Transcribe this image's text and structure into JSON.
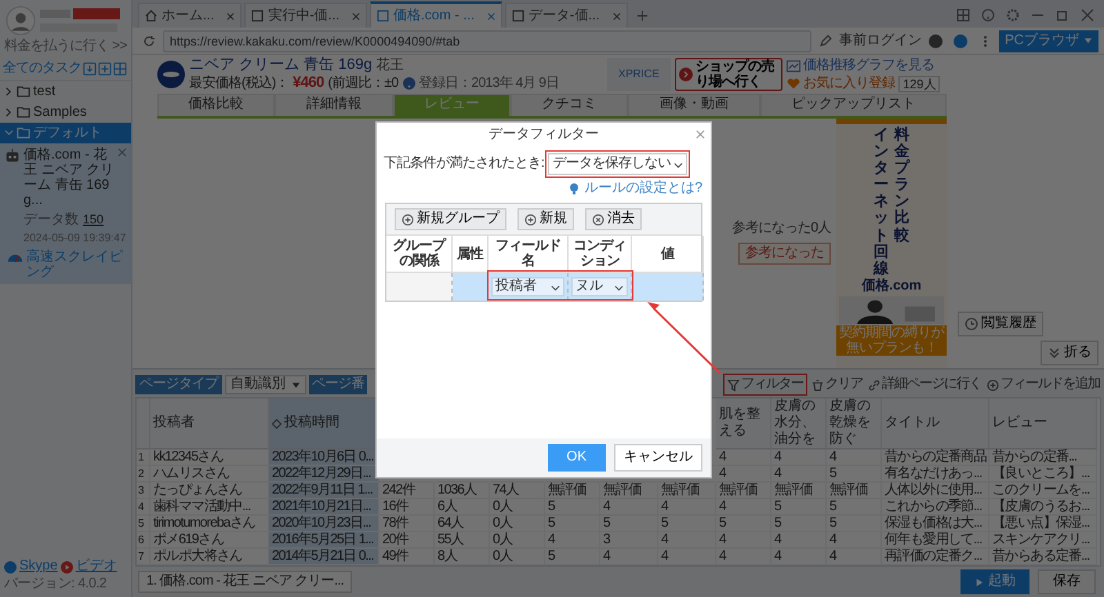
{
  "sidebar": {
    "upgrade_link": "料金を払うに行く >>",
    "tasks_title": "全てのタスク",
    "tree": [
      {
        "label": "test",
        "expanded": false,
        "selected": false
      },
      {
        "label": "Samples",
        "expanded": false,
        "selected": false
      },
      {
        "label": "デフォルト",
        "expanded": true,
        "selected": true,
        "tasks": [
          {
            "title": "価格.com - 花王 ニベア クリーム 青缶 169g...",
            "data_label": "データ数",
            "data_count": "150",
            "timestamp": "2024-05-09 19:39:47",
            "mode": "高速スクレイピング"
          }
        ]
      }
    ],
    "footer_links": [
      "Skype",
      "ビデオ"
    ],
    "version": "バージョン: 4.0.2"
  },
  "browser": {
    "tabs": [
      {
        "kind": "home",
        "label": "ホーム...",
        "selected": false
      },
      {
        "kind": "page",
        "label": "実行中-価...",
        "selected": false
      },
      {
        "kind": "page",
        "label": "価格.com - ...",
        "selected": true
      },
      {
        "kind": "page",
        "label": "データ-価...",
        "selected": false
      }
    ],
    "url": "https://review.kakaku.com/review/K0000494090/#tab",
    "login": "事前ログイン",
    "mode_button": "PCブラウザ"
  },
  "page": {
    "product": "ニベア クリーム 青缶 169g",
    "maker": "花王",
    "price_label": "最安価格(税込)：",
    "price": "¥460",
    "change": "(前週比：±0",
    "registered": "登録日：2013年 4月 9日",
    "shop_name": "XPRICE",
    "shop_button": "ショップの売り場へ行く",
    "chart_link": "価格推移グラフを見る",
    "favorite_link": "お気に入り登録",
    "favorite_count": "129人",
    "tabs": [
      {
        "label": "価格比較",
        "selected": false
      },
      {
        "label": "詳細情報",
        "selected": false
      },
      {
        "label": "レビュー",
        "selected": true
      },
      {
        "label": "クチコミ",
        "selected": false
      },
      {
        "label": "画像・動画",
        "selected": false
      },
      {
        "label": "ピックアップリスト",
        "selected": false
      }
    ],
    "helpful_note": "参考になった0人",
    "helpful_button": "参考になった",
    "ad": {
      "headline_1": "料金プラン比較",
      "headline_2": "インターネット回線",
      "brand": "価格.com",
      "tagline": "契約期間の縛りが無いプランも！"
    },
    "history_button": "閲覧履歴",
    "collapse_button": "折る"
  },
  "data_panel": {
    "page_type_label": "ページタイプ",
    "page_type": "自動識別",
    "page_number_label": "ページ番",
    "actions": [
      {
        "kind": "filter",
        "label": "フィルター"
      },
      {
        "kind": "clear",
        "label": "クリア"
      },
      {
        "kind": "detail",
        "label": "詳細ページに行く"
      },
      {
        "kind": "add",
        "label": "フィールドを追加"
      }
    ],
    "columns": [
      {
        "label": "投稿者",
        "selected": false
      },
      {
        "label": "投稿時間",
        "selected": true
      },
      null,
      null,
      null,
      null,
      null,
      null,
      {
        "label": "肌を整える",
        "selected": false
      },
      {
        "label": "皮膚の水分、油分を",
        "selected": false
      },
      {
        "label": "皮膚の乾燥を防ぐ",
        "selected": false
      },
      {
        "label": "タイトル",
        "selected": false
      },
      {
        "label": "レビュー",
        "selected": false
      }
    ],
    "rows": [
      {
        "index": "1",
        "cells": [
          "kk12345さん",
          "2023年10月6日 0...",
          null,
          null,
          null,
          null,
          null,
          null,
          "4",
          "4",
          "4",
          "昔からの定番商品",
          "昔からの定番..."
        ]
      },
      {
        "index": "2",
        "cells": [
          "ハムリスさん",
          "2022年12月29日...",
          null,
          null,
          null,
          null,
          null,
          null,
          "4",
          "4",
          "5",
          "有名なだけあっ...",
          "【良いところ】..."
        ]
      },
      {
        "index": "3",
        "cells": [
          "たっぴょんさん",
          "2022年9月11日 1...",
          "242件",
          "1036人",
          "74人",
          "無評価",
          "無評価",
          "無評価",
          "無評価",
          "無評価",
          "無評価",
          "人体以外に使用...",
          "このクリームを..."
        ]
      },
      {
        "index": "4",
        "cells": [
          "歯科ママ活動中...",
          "2021年10月21日...",
          "16件",
          "6人",
          "0人",
          "5",
          "4",
          "4",
          "4",
          "5",
          "5",
          "これからの季節...",
          "【皮膚のうるお..."
        ]
      },
      {
        "index": "5",
        "cells": [
          "tirimotumorebaさん",
          "2020年10月23日...",
          "78件",
          "64人",
          "0人",
          "5",
          "5",
          "5",
          "5",
          "5",
          "5",
          "保湿も価格は大...",
          "【悪い点】保湿..."
        ]
      },
      {
        "index": "6",
        "cells": [
          "ポメ619さん",
          "2016年5月25日 1...",
          "20件",
          "55人",
          "0人",
          "4",
          "3",
          "4",
          "4",
          "4",
          "4",
          "何年も愛用して...",
          "スキンケアクリ..."
        ]
      },
      {
        "index": "7",
        "cells": [
          "ポルポ大将さん",
          "2014年5月21日 0...",
          "49件",
          "8人",
          "0人",
          "5",
          "4",
          "4",
          "4",
          "4",
          "4",
          "再評価の定番ク...",
          "昔からある定番..."
        ]
      }
    ]
  },
  "dialog": {
    "title": "データフィルター",
    "condition_label": "下記条件が満たされたとき:",
    "action": "データを保存しない",
    "help_link": "ルールの設定とは?",
    "toolbar": [
      {
        "kind": "add",
        "label": "新規グループ"
      },
      {
        "kind": "add",
        "label": "新規"
      },
      {
        "kind": "remove",
        "label": "消去"
      }
    ],
    "columns": [
      "グループの関係",
      "属性",
      "フィールド名",
      "コンディション",
      "値"
    ],
    "rules": [
      {
        "field": "投稿者",
        "condition": "ヌル",
        "selected": true
      }
    ],
    "buttons": [
      {
        "kind": "primary",
        "label": "OK"
      },
      {
        "kind": "secondary",
        "label": "キャンセル"
      }
    ]
  },
  "bottom_bar": {
    "task_tab": "1. 価格.com - 花王 ニベア クリー...",
    "start_button": "起動",
    "save_button": "保存"
  }
}
